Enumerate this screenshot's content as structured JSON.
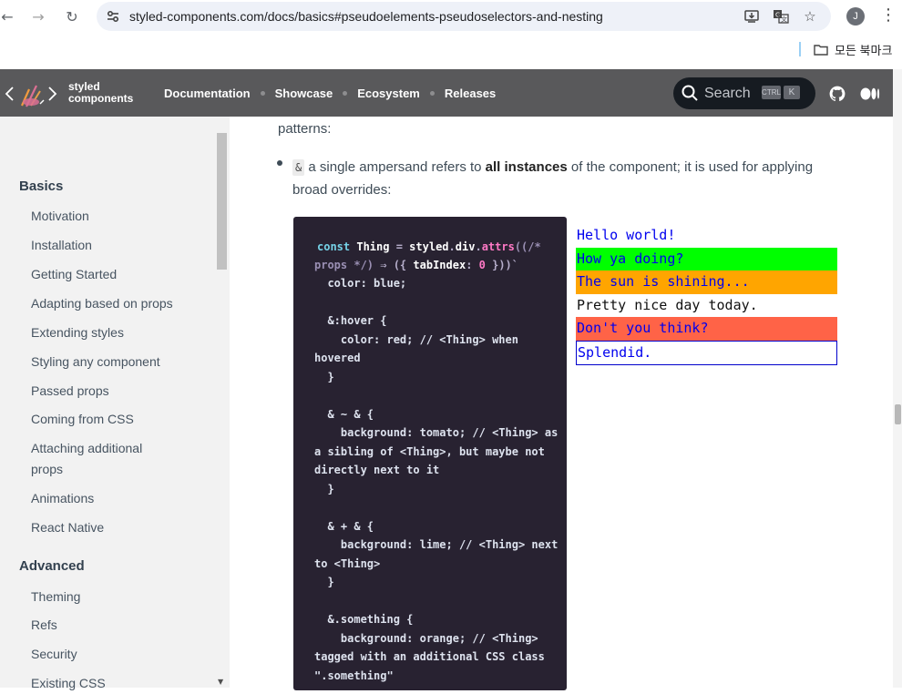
{
  "browser": {
    "url": "styled-components.com/docs/basics#pseudoelements-pseudoselectors-and-nesting",
    "avatar": "J",
    "bookmarks_label": "모든 북마크"
  },
  "header": {
    "logo_line1": "styled",
    "logo_line2": "components",
    "nav": [
      "Documentation",
      "Showcase",
      "Ecosystem",
      "Releases"
    ],
    "search_placeholder": "Search",
    "kbd_ctrl": "CTRL",
    "kbd_k": "K"
  },
  "sidebar": {
    "section1": "Basics",
    "basics_items": [
      "Motivation",
      "Installation",
      "Getting Started",
      "Adapting based on props",
      "Extending styles",
      "Styling any component",
      "Passed props",
      "Coming from CSS",
      "Attaching additional props",
      "Animations",
      "React Native"
    ],
    "section2": "Advanced",
    "advanced_items": [
      "Theming",
      "Refs",
      "Security",
      "Existing CSS"
    ]
  },
  "content": {
    "lead": "patterns:",
    "bullet_code": "&",
    "bullet_pre": " a single ampersand refers to ",
    "bullet_bold": "all instances",
    "bullet_post": " of the component; it is used for applying broad overrides:",
    "code_line1": {
      "kw": "const",
      "name": "Thing",
      "eq": " = ",
      "obj": "styled",
      "dot1": ".",
      "tag": "div",
      "dot2": ".",
      "fn": "attrs",
      "open": "((/*"
    },
    "code_line2": {
      "comment": "props */) ",
      "arrow": "⇒",
      "brace_open": " ({ ",
      "key": "tabIndex",
      "colon": ": ",
      "num": "0",
      "brace_close": " }))`"
    },
    "code_body": "  color: blue;\n\n  &:hover {\n    color: red; // <Thing> when hovered\n  }\n\n  & ~ & {\n    background: tomato; // <Thing> as a sibling of <Thing>, but maybe not directly next to it\n  }\n\n  & + & {\n    background: lime; // <Thing> next to <Thing>\n  }\n\n  &.something {\n    background: orange; // <Thing> tagged with an additional CSS class \".something\"",
    "preview": [
      "Hello world!",
      "How ya doing?",
      "The sun is shining...",
      "Pretty nice day today.",
      "Don't you think?",
      "Splendid."
    ]
  }
}
